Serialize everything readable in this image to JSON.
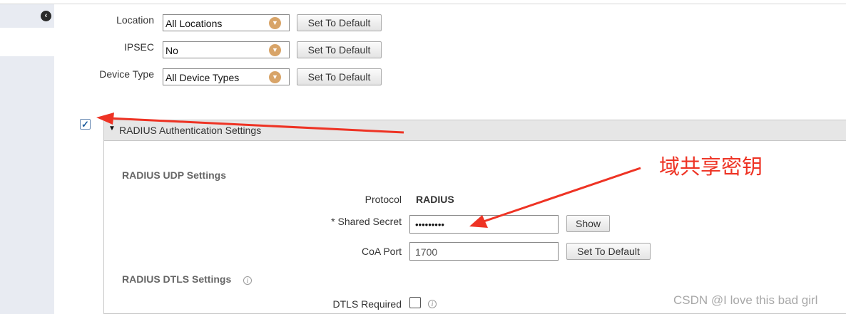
{
  "sidebar": {
    "collapse_icon": "chevron-left-icon"
  },
  "filters": [
    {
      "label": "Location",
      "value": "All Locations",
      "button": "Set To Default"
    },
    {
      "label": "IPSEC",
      "value": "No",
      "button": "Set To Default"
    },
    {
      "label": "Device Type",
      "value": "All Device Types",
      "button": "Set To Default"
    }
  ],
  "radius_panel": {
    "enabled": true,
    "title": "RADIUS Authentication Settings",
    "udp_title": "RADIUS UDP Settings",
    "protocol_label": "Protocol",
    "protocol_value": "RADIUS",
    "shared_secret_label": "* Shared Secret",
    "shared_secret_value": "•••••••••",
    "show_button": "Show",
    "coa_label": "CoA Port",
    "coa_value": "1700",
    "coa_button": "Set To Default",
    "dtls_title": "RADIUS DTLS Settings",
    "dtls_required_label": "DTLS Required",
    "dtls_required": false
  },
  "annotation": {
    "text": "域共享密钥",
    "color": "#ee3324"
  },
  "watermark": "CSDN @I love this bad girl"
}
